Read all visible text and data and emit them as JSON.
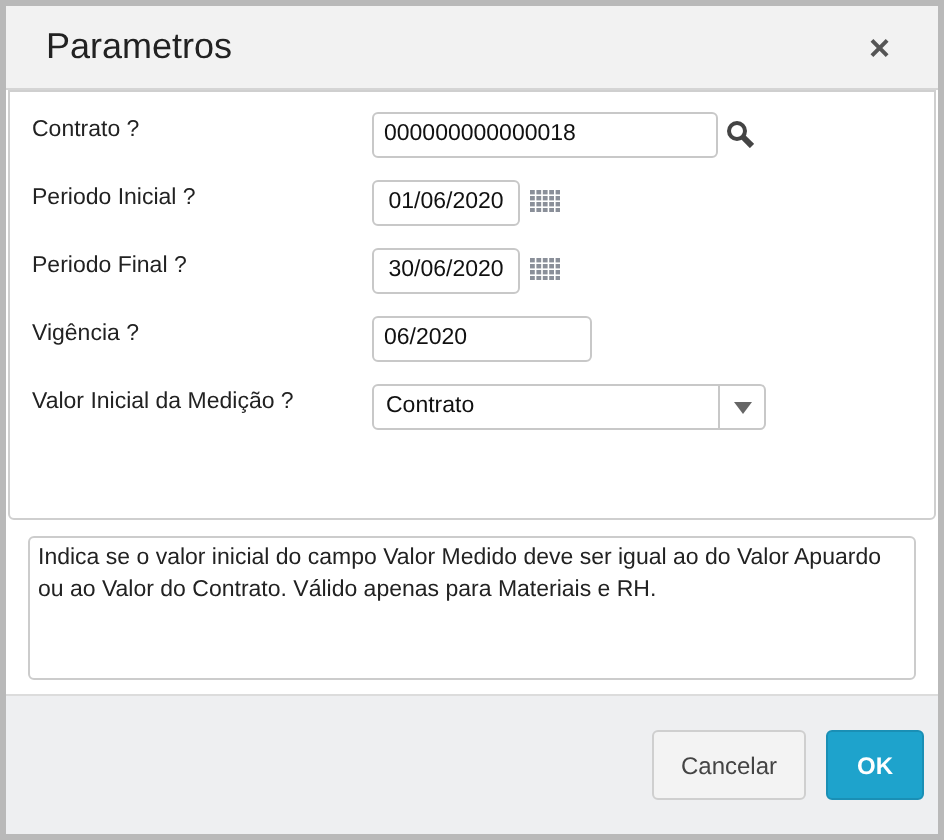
{
  "window": {
    "title": "Parametros",
    "close": "×"
  },
  "fields": [
    {
      "label": "Contrato ?",
      "value": "000000000000018",
      "kind": "lookup"
    },
    {
      "label": "Periodo Inicial ?",
      "value": "01/06/2020",
      "kind": "date"
    },
    {
      "label": "Periodo Final ?",
      "value": "30/06/2020",
      "kind": "date"
    },
    {
      "label": "Vigência ?",
      "value": "06/2020",
      "kind": "text"
    },
    {
      "label": "Valor Inicial da Medição ?",
      "value": "Contrato",
      "kind": "select"
    }
  ],
  "help_text": "Indica se o valor inicial do campo Valor Medido deve ser igual ao do Valor Apuardo ou ao Valor do Contrato. Válido apenas para Materiais e RH.",
  "buttons": [
    {
      "label": "Cancelar",
      "kind": "secondary"
    },
    {
      "label": "OK",
      "kind": "primary"
    }
  ]
}
